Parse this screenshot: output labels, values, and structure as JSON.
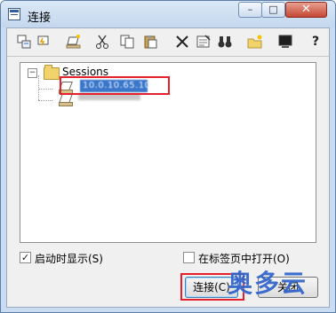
{
  "window": {
    "title": "连接"
  },
  "toolbar": {
    "icons": [
      "connect-icon",
      "quick-connect-icon",
      "new-session-icon",
      "cut-icon",
      "copy-icon",
      "paste-icon",
      "delete-icon",
      "properties-icon",
      "find-icon",
      "new-folder-icon",
      "desktop-icon",
      "help-icon"
    ]
  },
  "tree": {
    "root_label": "Sessions",
    "sessions": [
      {
        "label": "10.0.10.65.10",
        "selected": true
      },
      {
        "label": "",
        "selected": false
      }
    ]
  },
  "options": {
    "show_on_startup_label": "启动时显示(S)",
    "show_on_startup": true,
    "open_in_tab_label": "在标签页中打开(O)",
    "open_in_tab": false
  },
  "buttons": {
    "connect_label": "连接(C)",
    "close_label": "关闭"
  },
  "watermark": "奥多云",
  "colors": {
    "highlight": "#e4202a",
    "selection": "#3a76c9"
  }
}
